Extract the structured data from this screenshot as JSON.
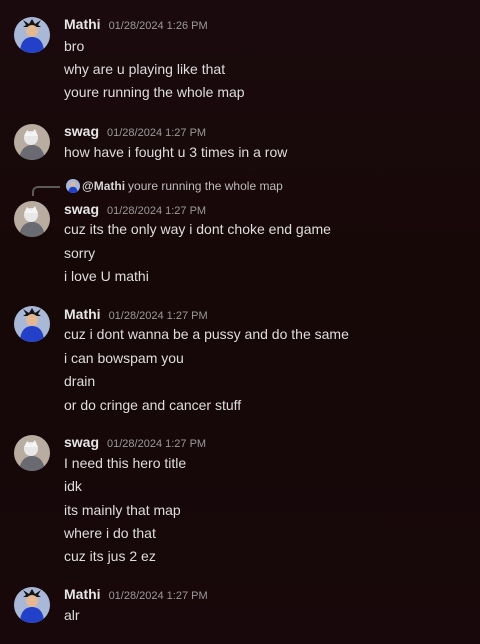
{
  "messages": [
    {
      "author": "Mathi",
      "time": "01/28/2024 1:26 PM",
      "avatar_icon": "mathi-avatar",
      "lines": [
        "bro",
        "why are u playing like that",
        "youre running the whole map"
      ]
    },
    {
      "author": "swag",
      "time": "01/28/2024 1:27 PM",
      "avatar_icon": "swag-avatar",
      "lines": [
        "how have i fought u 3 times in a row"
      ]
    },
    {
      "author": "swag",
      "time": "01/28/2024 1:27 PM",
      "avatar_icon": "swag-avatar",
      "reply": {
        "mention": "@Mathi",
        "text": "youre running the whole map"
      },
      "lines": [
        "cuz its the only way i dont choke end game",
        "sorry",
        "i love U mathi"
      ]
    },
    {
      "author": "Mathi",
      "time": "01/28/2024 1:27 PM",
      "avatar_icon": "mathi-avatar",
      "lines": [
        "cuz i dont wanna be a pussy and do the same",
        "i can bowspam you",
        "drain",
        "or do cringe and cancer stuff"
      ]
    },
    {
      "author": "swag",
      "time": "01/28/2024 1:27 PM",
      "avatar_icon": "swag-avatar",
      "lines": [
        "I need this hero title",
        "idk",
        "its mainly that map",
        "where i do that",
        "cuz its jus 2 ez"
      ]
    },
    {
      "author": "Mathi",
      "time": "01/28/2024 1:27 PM",
      "avatar_icon": "mathi-avatar",
      "lines": [
        "alr"
      ]
    }
  ]
}
